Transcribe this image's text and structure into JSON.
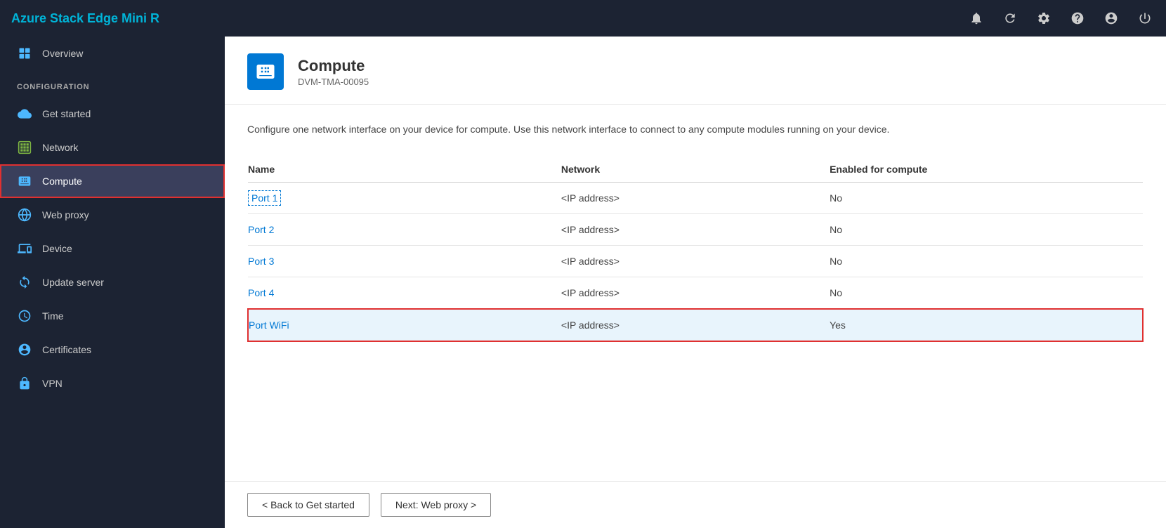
{
  "app": {
    "title": "Azure Stack Edge Mini R"
  },
  "topbar": {
    "icons": [
      "bell",
      "refresh",
      "settings",
      "help",
      "copyright",
      "power"
    ]
  },
  "sidebar": {
    "section_label": "CONFIGURATION",
    "items": [
      {
        "id": "overview",
        "label": "Overview",
        "icon": "⊞",
        "active": false
      },
      {
        "id": "get-started",
        "label": "Get started",
        "icon": "☁",
        "active": false
      },
      {
        "id": "network",
        "label": "Network",
        "icon": "▦",
        "active": false
      },
      {
        "id": "compute",
        "label": "Compute",
        "icon": "⚙",
        "active": true
      },
      {
        "id": "web-proxy",
        "label": "Web proxy",
        "icon": "⊕",
        "active": false
      },
      {
        "id": "device",
        "label": "Device",
        "icon": "≡",
        "active": false
      },
      {
        "id": "update-server",
        "label": "Update server",
        "icon": "⬆",
        "active": false
      },
      {
        "id": "time",
        "label": "Time",
        "icon": "⏰",
        "active": false
      },
      {
        "id": "certificates",
        "label": "Certificates",
        "icon": "👤",
        "active": false
      },
      {
        "id": "vpn",
        "label": "VPN",
        "icon": "🔒",
        "active": false
      }
    ]
  },
  "content": {
    "header": {
      "title": "Compute",
      "subtitle": "DVM-TMA-00095"
    },
    "description": "Configure one network interface on your device for compute. Use this network interface to connect to any compute modules running on your device.",
    "table": {
      "columns": [
        "Name",
        "Network",
        "Enabled for compute"
      ],
      "rows": [
        {
          "name": "Port 1",
          "network": "<IP address>",
          "enabled": "No",
          "link": true,
          "selected": false,
          "highlighted": false
        },
        {
          "name": "Port 2",
          "network": "<IP address>",
          "enabled": "No",
          "link": true,
          "selected": false,
          "highlighted": false
        },
        {
          "name": "Port 3",
          "network": "<IP address>",
          "enabled": "No",
          "link": true,
          "selected": false,
          "highlighted": false
        },
        {
          "name": "Port 4",
          "network": "<IP address>",
          "enabled": "No",
          "link": true,
          "selected": false,
          "highlighted": false
        },
        {
          "name": "Port WiFi",
          "network": "<IP address>",
          "enabled": "Yes",
          "link": true,
          "selected": true,
          "highlighted": true
        }
      ]
    },
    "footer": {
      "back_button": "< Back to Get started",
      "next_button": "Next: Web proxy >"
    }
  }
}
